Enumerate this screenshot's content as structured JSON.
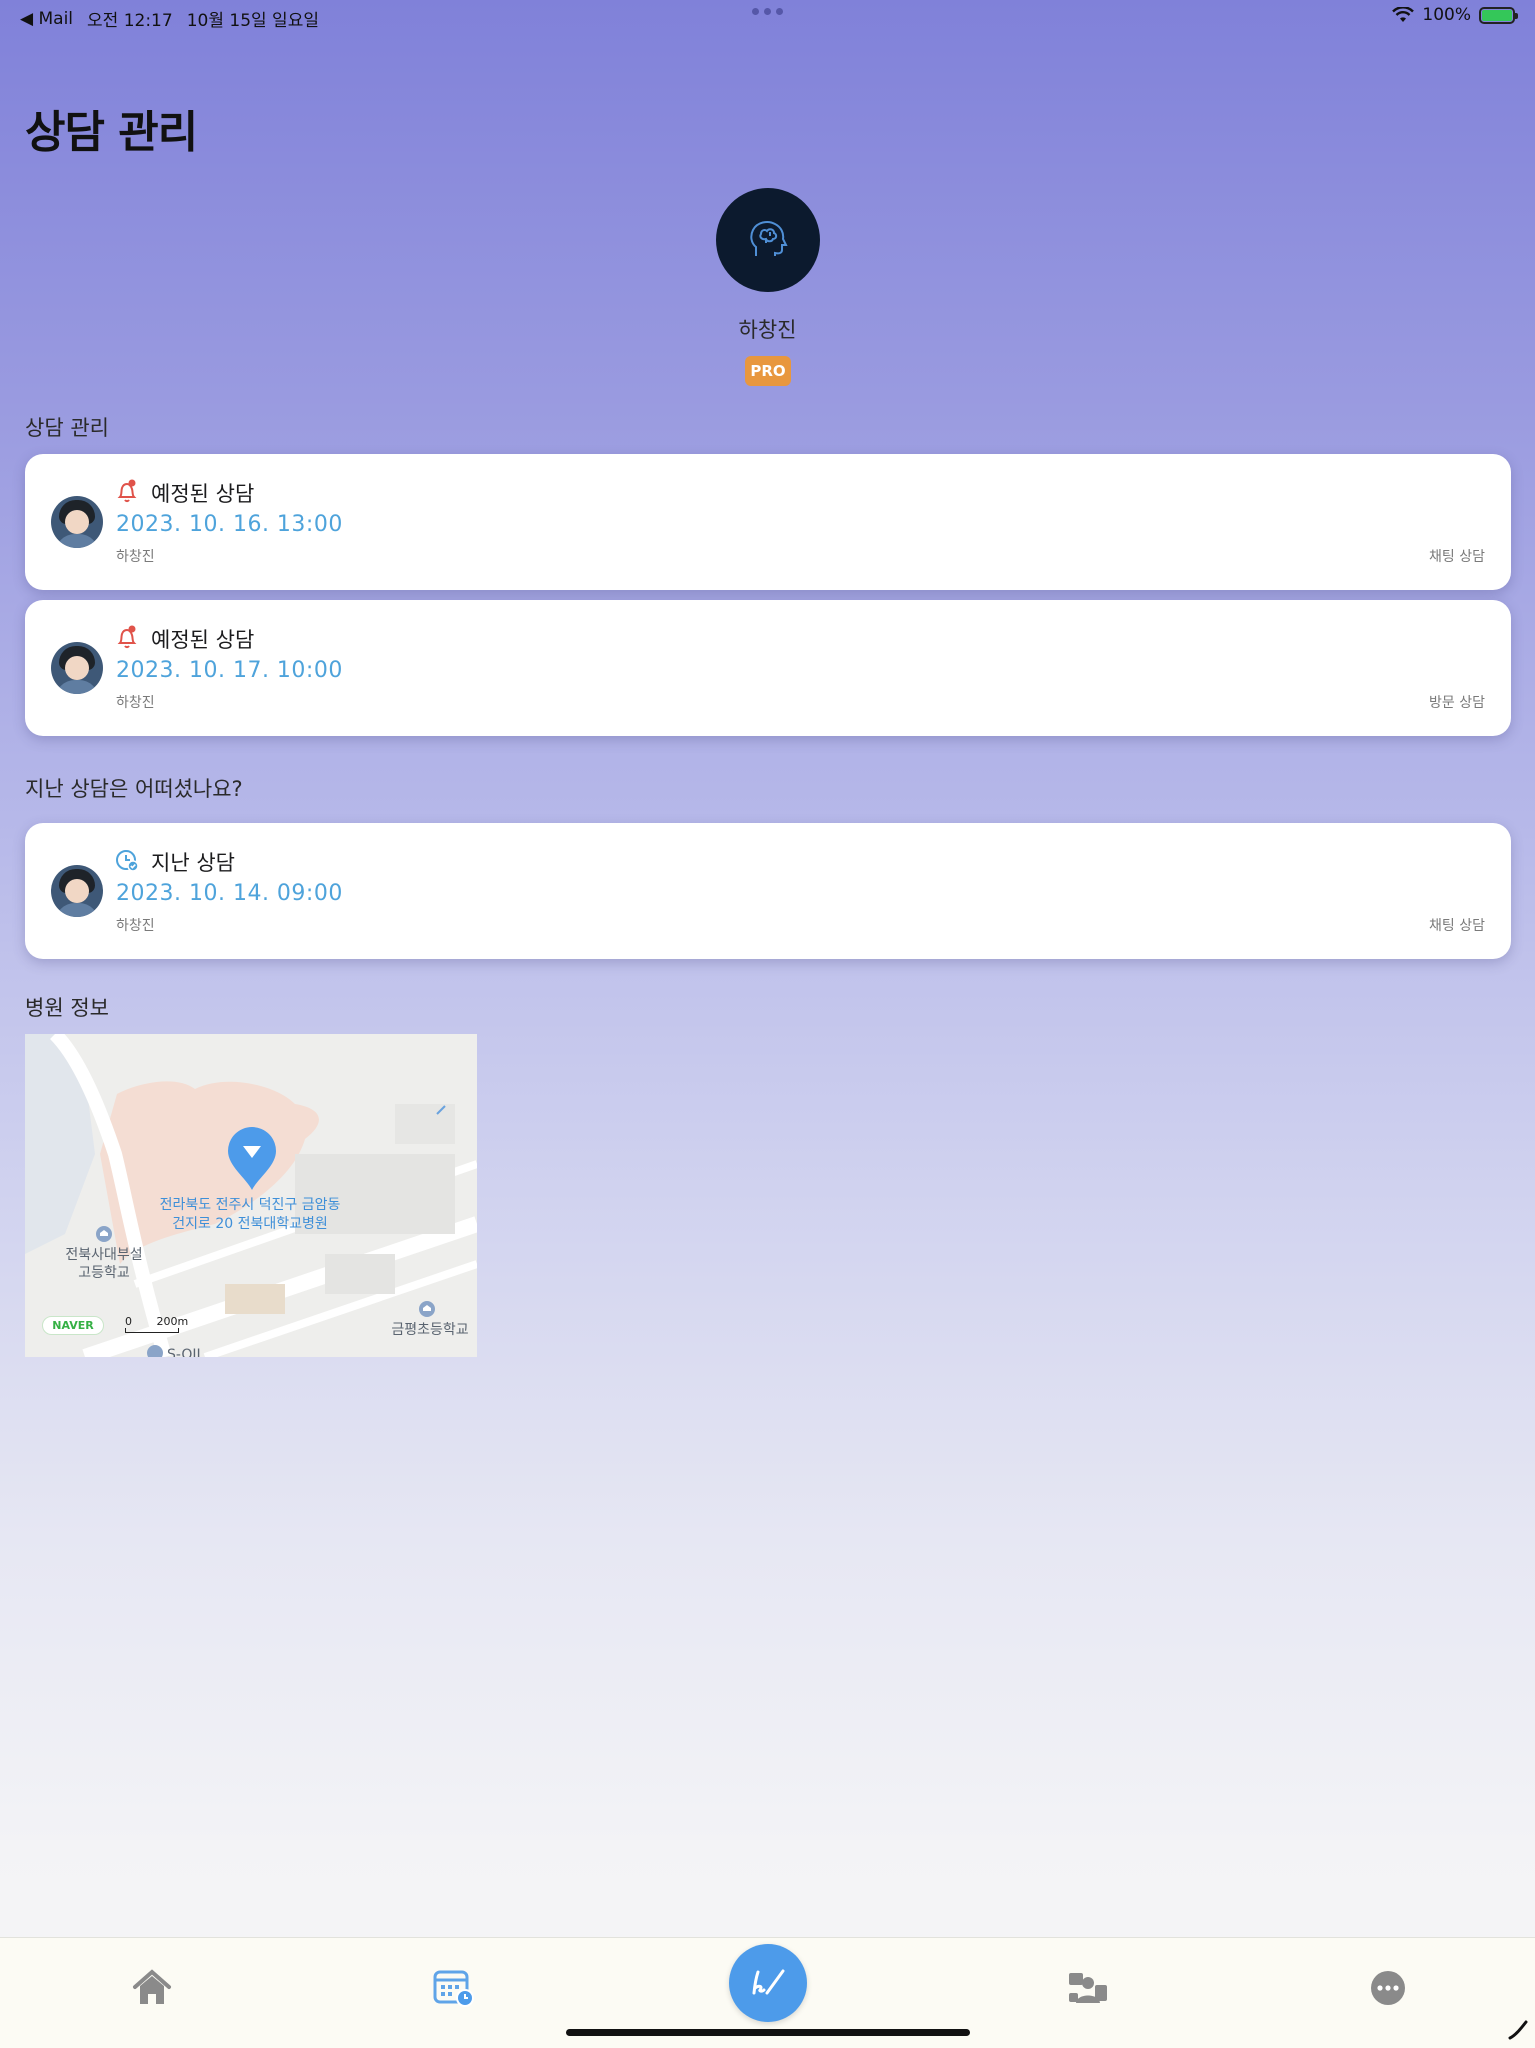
{
  "status_bar": {
    "back_app": "◀ Mail",
    "time": "오전 12:17",
    "date": "10월 15일 일요일",
    "battery": "100%"
  },
  "page": {
    "title": "상담 관리"
  },
  "profile": {
    "name": "하창진",
    "badge": "PRO"
  },
  "sections": {
    "upcoming": "상담 관리",
    "past": "지난 상담은 어떠셨나요?",
    "hospital": "병원 정보"
  },
  "upcoming_consultations": [
    {
      "title": "예정된 상담",
      "datetime": "2023. 10. 16. 13:00",
      "counselor": "하창진",
      "type": "채팅 상담",
      "icon": "bell-icon"
    },
    {
      "title": "예정된 상담",
      "datetime": "2023. 10. 17. 10:00",
      "counselor": "하창진",
      "type": "방문 상담",
      "icon": "bell-icon"
    }
  ],
  "past_consultations": [
    {
      "title": "지난 상담",
      "datetime": "2023. 10. 14. 09:00",
      "counselor": "하창진",
      "type": "채팅 상담",
      "icon": "clock-check-icon"
    }
  ],
  "map": {
    "address_line1": "전라북도 전주시 덕진구 금암동",
    "address_line2": "건지로 20 전북대학교병원",
    "school1_line1": "전북사대부설",
    "school1_line2": "고등학교",
    "school2": "금평초등학교",
    "fuel": "S-OIL",
    "brand": "NAVER",
    "scale_start": "0",
    "scale_end": "200m"
  },
  "tabbar": {
    "tabs": [
      "home-icon",
      "calendar-icon",
      "write-icon",
      "counselor-icon",
      "more-icon"
    ]
  },
  "colors": {
    "accent": "#4d9bea",
    "date_blue": "#4ea3db",
    "badge_orange": "#e8973e",
    "bell_red": "#e0534a"
  }
}
